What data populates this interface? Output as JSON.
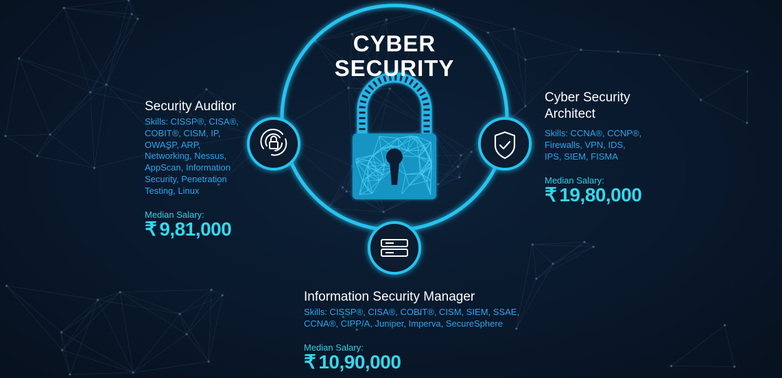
{
  "title": {
    "line1": "CYBER",
    "line2": "SECURITY"
  },
  "roles": {
    "auditor": {
      "title": "Security Auditor",
      "skills": [
        "Skills: CISSP®, CISA®,",
        "COBIT®, CISM, IP,",
        "OWASP, ARP,",
        "Networking, Nessus,",
        "AppScan, Information",
        "Security, Penetration",
        "Testing, Linux"
      ],
      "salary_label": "Median Salary:",
      "salary": "9,81,000",
      "icon": "fingerprint-lock-icon"
    },
    "architect": {
      "title_line1": "Cyber Security",
      "title_line2": "Architect",
      "skills": [
        "Skills: CCNA®, CCNP®,",
        "Firewalls, VPN, IDS,",
        "IPS, SIEM, FISMA"
      ],
      "salary_label": "Median Salary:",
      "salary": "19,80,000",
      "icon": "shield-check-icon"
    },
    "manager": {
      "title": "Information Security Manager",
      "skills": [
        "Skills: CISSP®, CISA®, COBIT®, CISM, SIEM, SSAE,",
        "CCNA®, CIPP/A, Juniper, Imperva, SecureSphere"
      ],
      "salary_label": "Median Salary:",
      "salary": "10,90,000",
      "icon": "server-icon"
    }
  },
  "currency_symbol": "₹",
  "colors": {
    "accent": "#1fb6e8",
    "salary": "#36d7ea",
    "skills": "#29a6ee",
    "background": "#0a1a2e"
  },
  "center_icon": "padlock-icon"
}
